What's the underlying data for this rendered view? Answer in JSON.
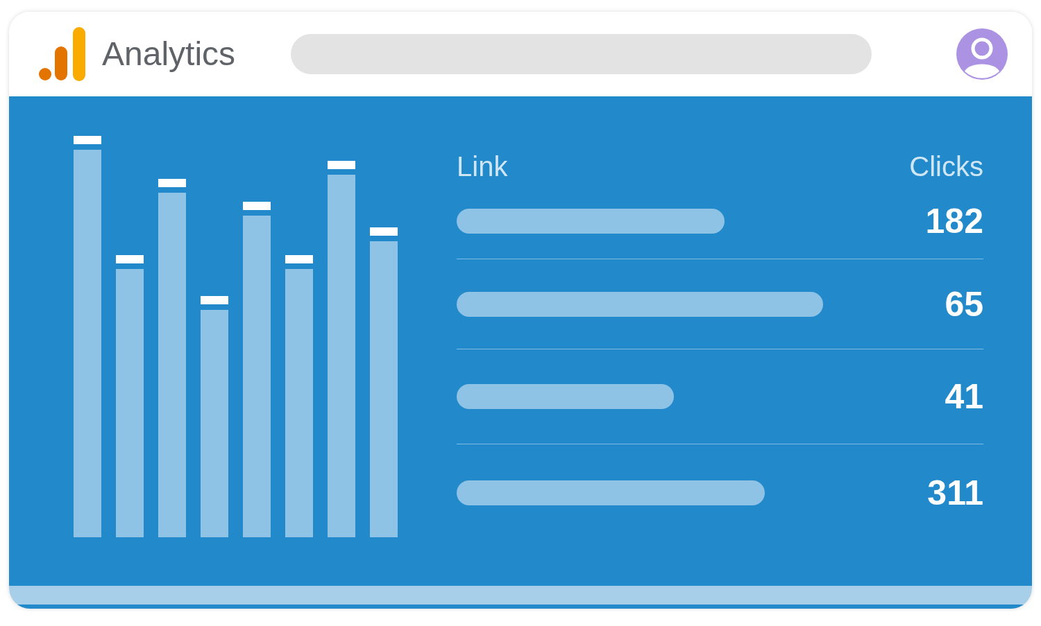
{
  "app": {
    "title": "Analytics"
  },
  "table": {
    "columns": [
      "Link",
      "Clicks"
    ],
    "rows": [
      {
        "clicks": "182"
      },
      {
        "clicks": "65"
      },
      {
        "clicks": "41"
      },
      {
        "clicks": "311"
      }
    ]
  }
}
